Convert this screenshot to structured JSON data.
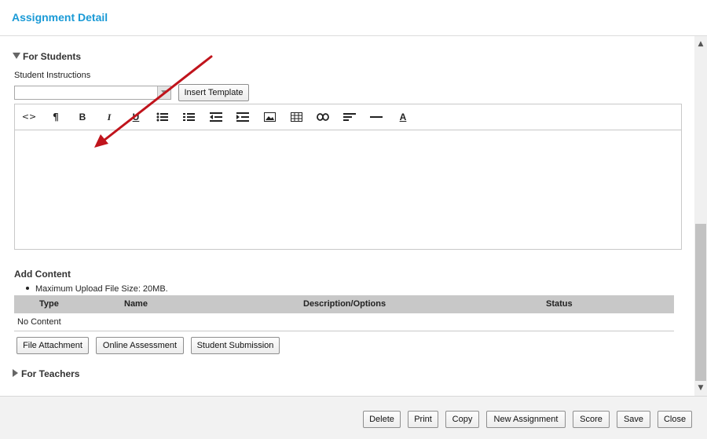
{
  "dialog": {
    "title": "Assignment Detail"
  },
  "for_students": {
    "heading": "For Students",
    "instructions_label": "Student Instructions",
    "template_select_value": "",
    "insert_template_label": "Insert Template",
    "editor_toolbar": [
      {
        "name": "code-icon",
        "glyph": "<>"
      },
      {
        "name": "paragraph-icon",
        "glyph": "¶"
      },
      {
        "name": "bold-icon",
        "glyph": "B"
      },
      {
        "name": "italic-icon",
        "glyph": "I"
      },
      {
        "name": "underline-icon",
        "glyph": "U"
      },
      {
        "name": "unordered-list-icon",
        "glyph": "list"
      },
      {
        "name": "ordered-list-icon",
        "glyph": "olist"
      },
      {
        "name": "outdent-icon",
        "glyph": "outdent"
      },
      {
        "name": "indent-icon",
        "glyph": "indent"
      },
      {
        "name": "image-icon",
        "glyph": "image"
      },
      {
        "name": "table-icon",
        "glyph": "table"
      },
      {
        "name": "link-icon",
        "glyph": "link"
      },
      {
        "name": "align-left-icon",
        "glyph": "align"
      },
      {
        "name": "horizontal-rule-icon",
        "glyph": "hr"
      },
      {
        "name": "font-color-icon",
        "glyph": "A"
      }
    ],
    "editor_content": ""
  },
  "add_content": {
    "heading": "Add Content",
    "upload_note": "Maximum Upload File Size: 20MB.",
    "columns": [
      "Type",
      "Name",
      "Description/Options",
      "Status"
    ],
    "empty_text": "No Content",
    "buttons": {
      "file_attachment": "File Attachment",
      "online_assessment": "Online Assessment",
      "student_submission": "Student Submission"
    }
  },
  "for_teachers": {
    "heading": "For Teachers"
  },
  "footer_buttons": {
    "delete": "Delete",
    "print": "Print",
    "copy": "Copy",
    "new_assignment": "New Assignment",
    "score": "Score",
    "save": "Save",
    "close": "Close"
  },
  "colors": {
    "title": "#1a9ad6",
    "annotation_arrow": "#c0141c",
    "table_header": "#c8c8c8"
  }
}
